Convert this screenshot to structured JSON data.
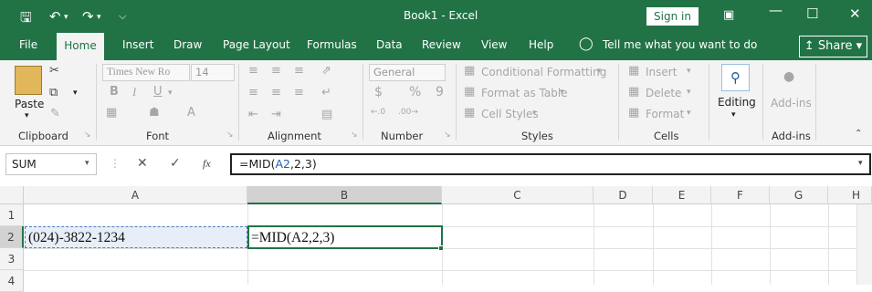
{
  "titlebar": {
    "title": "Book1  -  Excel",
    "sign_in": "Sign in"
  },
  "tabs": [
    "File",
    "Home",
    "Insert",
    "Draw",
    "Page Layout",
    "Formulas",
    "Data",
    "Review",
    "View",
    "Help"
  ],
  "tell_me": "Tell me what you want to do",
  "share": "Share",
  "ribbon": {
    "clipboard": {
      "paste": "Paste",
      "label": "Clipboard"
    },
    "font": {
      "name": "Times New Ro",
      "size": "14",
      "label": "Font",
      "bold": "B",
      "italic": "I",
      "underline": "U"
    },
    "alignment": {
      "label": "Alignment"
    },
    "number": {
      "format": "General",
      "label": "Number",
      "currency": "$",
      "percent": "%",
      "comma": "9"
    },
    "styles": {
      "conditional": "Conditional Formatting",
      "format_table": "Format as Table",
      "cell_styles": "Cell Styles",
      "label": "Styles"
    },
    "cells": {
      "insert": "Insert",
      "delete": "Delete",
      "format": "Format",
      "label": "Cells"
    },
    "editing": {
      "label": "Editing"
    },
    "addins": {
      "button": "Add-ins",
      "label": "Add-ins"
    }
  },
  "formula_bar": {
    "name_box": "SUM",
    "fx": "fx",
    "formula_prefix": "=MID(",
    "formula_ref": "A2",
    "formula_suffix": ",2,3)"
  },
  "grid": {
    "columns": [
      "A",
      "B",
      "C",
      "D",
      "E",
      "F",
      "G",
      "H"
    ],
    "rows": [
      "1",
      "2",
      "3",
      "4"
    ],
    "cells": {
      "A2": "(024)-3822-1234",
      "B2": "=MID(A2,2,3)"
    }
  },
  "colors": {
    "accent": "#217346",
    "ref": "#1f5fbf"
  }
}
